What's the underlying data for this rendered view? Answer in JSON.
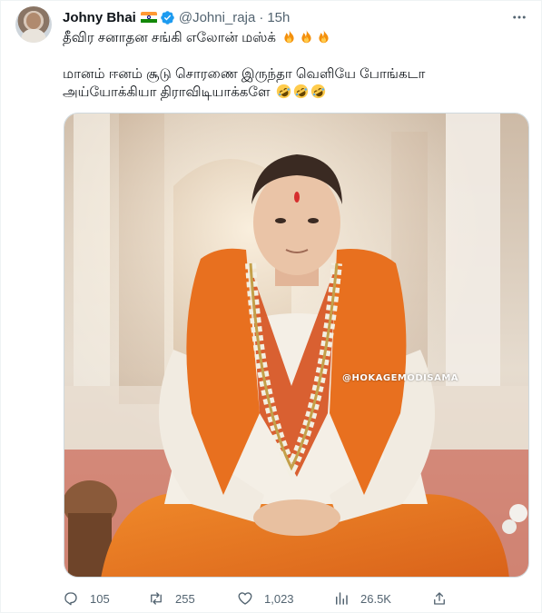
{
  "tweet": {
    "author": {
      "name": "Johny Bhai",
      "handle": "@Johni_raja",
      "flag": "india-flag",
      "verified": true
    },
    "separator": "·",
    "time": "15h",
    "text_lines": [
      "தீவிர சனாதன சங்கி எலோன் மஸ்க்",
      "மானம் ஈனம் சூடு சொரணை இருந்தா வெளியே போங்கடா",
      "அய்யோக்கியா திராவிடியாக்களே"
    ],
    "line1_emoji": "fire-emoji",
    "line3_emoji": "rolling-on-floor-laughing-emoji",
    "media": {
      "watermark": "@HOKAGEMODISAMA"
    },
    "stats": {
      "replies": "105",
      "retweets": "255",
      "likes": "1,023",
      "views": "26.5K"
    }
  },
  "colors": {
    "text_primary": "#0f1419",
    "text_secondary": "#536471",
    "verified_blue": "#1d9bf0",
    "border": "#eff3f4"
  }
}
